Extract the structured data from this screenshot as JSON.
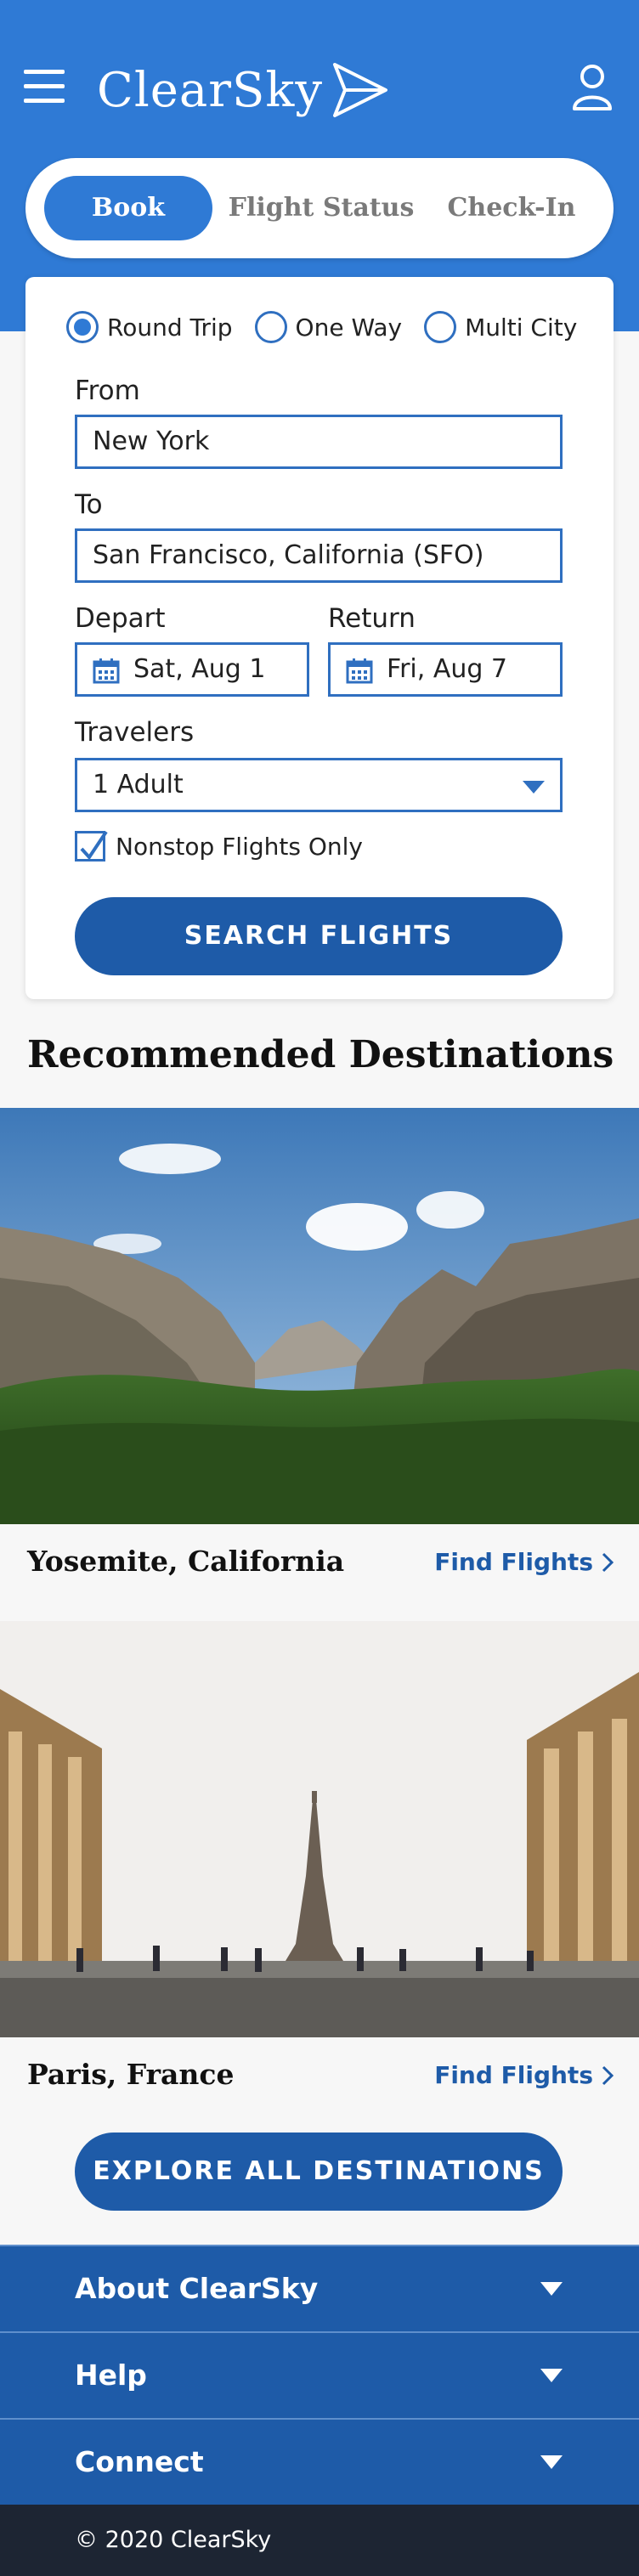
{
  "header": {
    "app_name": "ClearSky"
  },
  "tabs": [
    {
      "label": "Book",
      "active": true
    },
    {
      "label": "Flight Status",
      "active": false
    },
    {
      "label": "Check-In",
      "active": false
    }
  ],
  "booking_form": {
    "trip_types": [
      {
        "label": "Round Trip",
        "checked": true
      },
      {
        "label": "One Way",
        "checked": false
      },
      {
        "label": "Multi City",
        "checked": false
      }
    ],
    "from_label": "From",
    "from_value": "New York",
    "to_label": "To",
    "to_value": "San Francisco, California (SFO)",
    "depart_label": "Depart",
    "depart_value": "Sat, Aug 1",
    "return_label": "Return",
    "return_value": "Fri, Aug 7",
    "travelers_label": "Travelers",
    "travelers_value": "1 Adult",
    "nonstop_label": "Nonstop Flights Only",
    "nonstop_checked": true,
    "search_button": "SEARCH FLIGHTS"
  },
  "recommended": {
    "title": "Recommended Destinations",
    "destinations": [
      {
        "name": "Yosemite, California",
        "link": "Find Flights"
      },
      {
        "name": "Paris, France",
        "link": "Find Flights"
      }
    ],
    "explore_button": "EXPLORE ALL DESTINATIONS"
  },
  "footer": {
    "sections": [
      {
        "label": "About ClearSky"
      },
      {
        "label": "Help"
      },
      {
        "label": "Connect"
      }
    ],
    "copyright": "© 2020 ClearSky"
  },
  "colors": {
    "brand_blue": "#2f7ad5",
    "dark_blue": "#1e5ba8",
    "footer_navy": "#1d2533"
  }
}
